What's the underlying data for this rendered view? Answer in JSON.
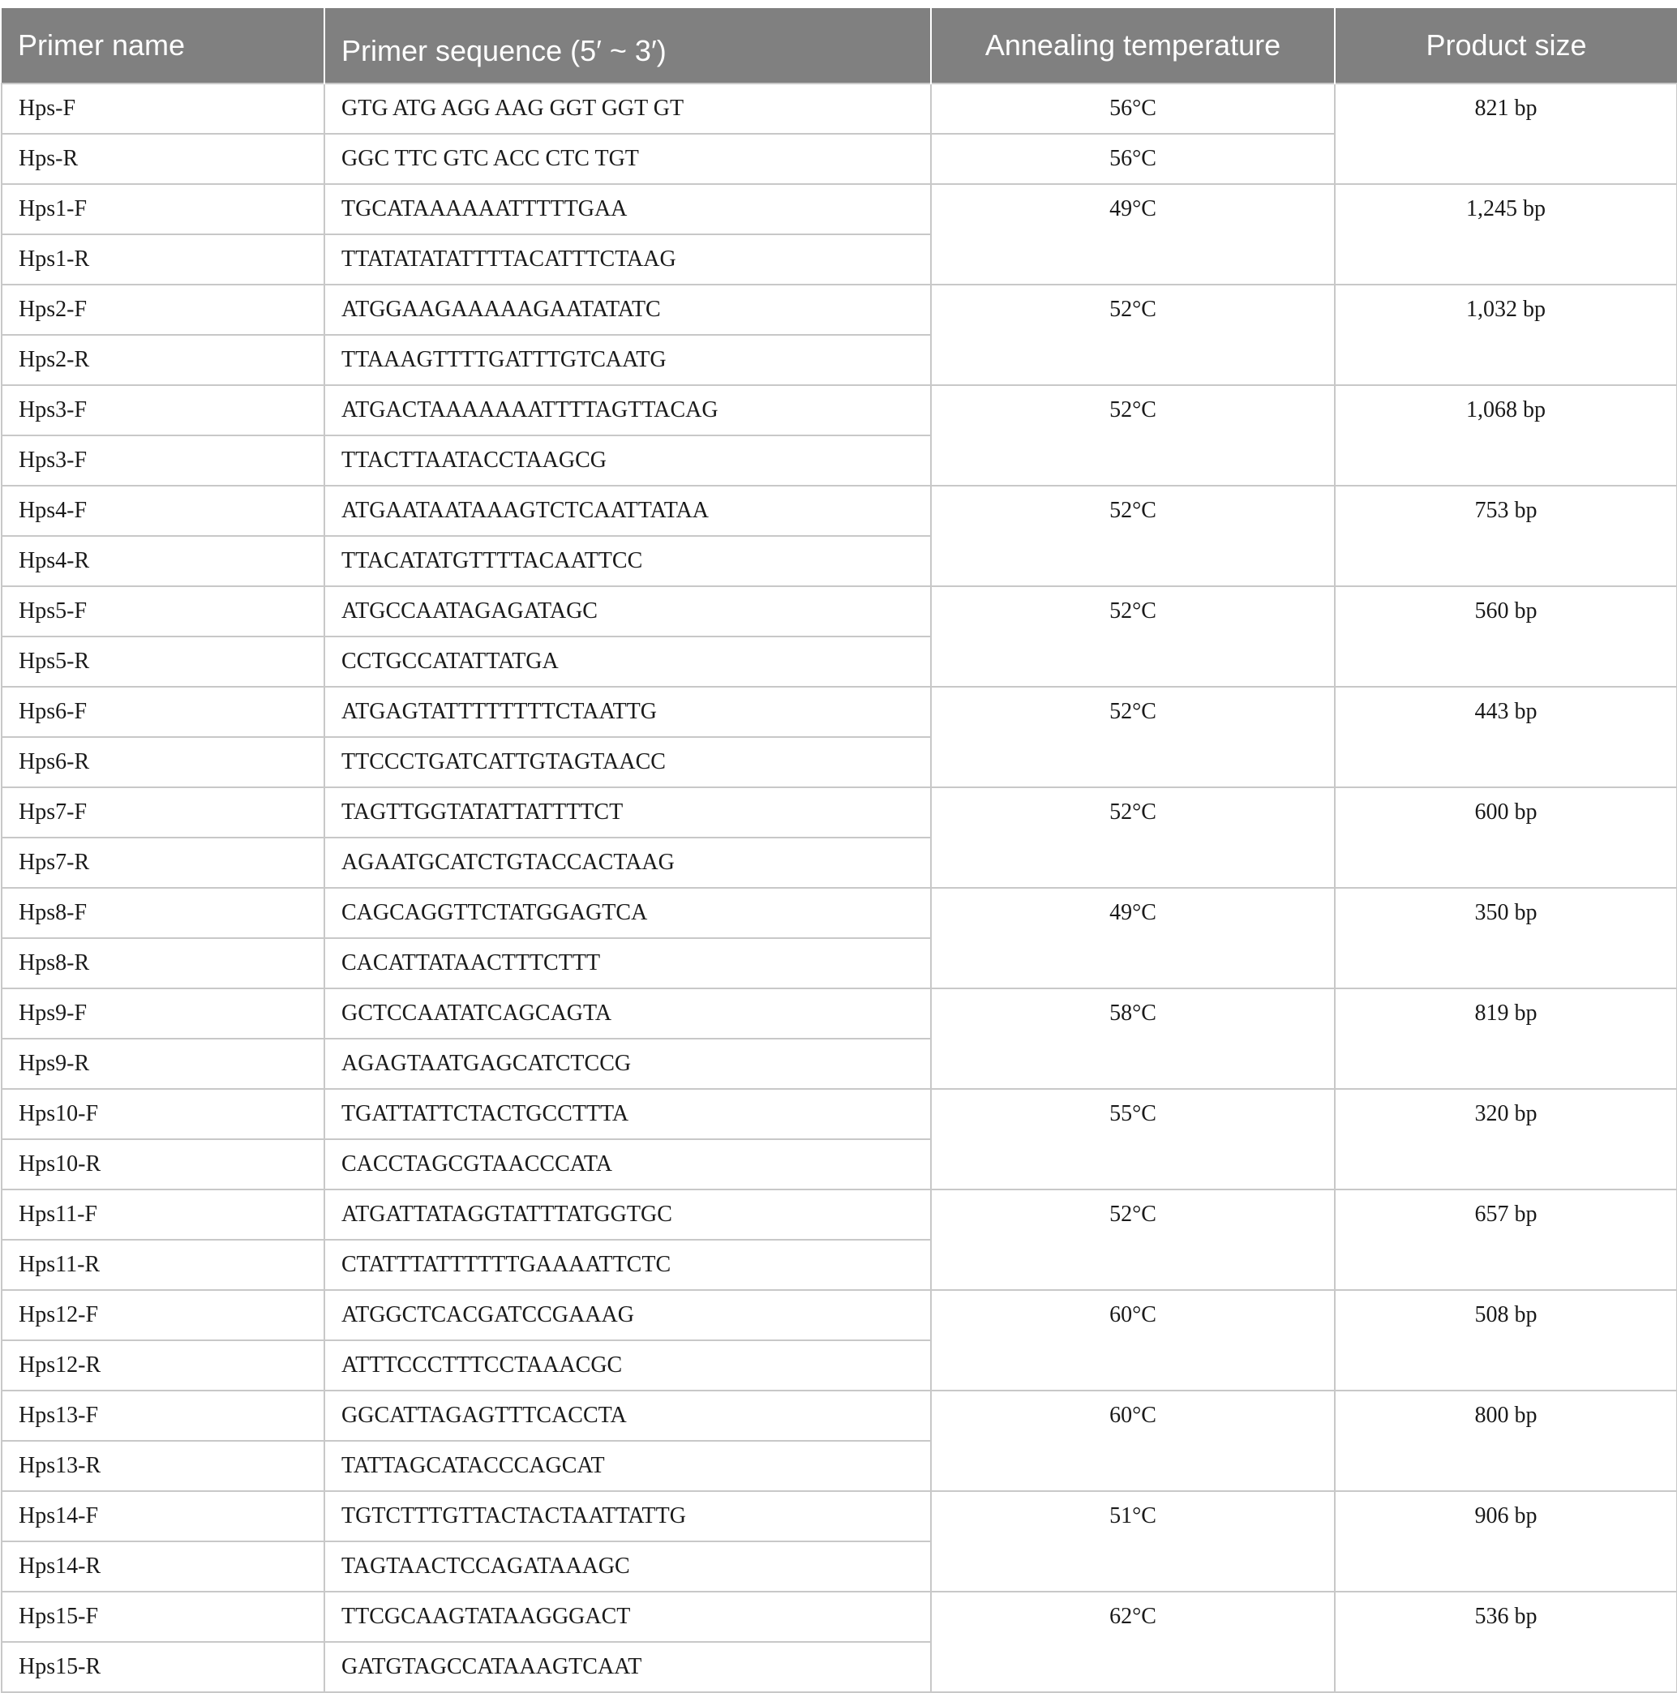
{
  "table": {
    "headers": [
      "Primer name",
      "Primer sequence (5′ ~ 3′)",
      "Annealing temperature",
      "Product size"
    ],
    "groups": [
      {
        "rows": [
          {
            "name": "Hps-F",
            "sequence": "GTG ATG AGG AAG GGT GGT GT",
            "temp": "56°C"
          },
          {
            "name": "Hps-R",
            "sequence": "GGC TTC GTC ACC CTC TGT",
            "temp": "56°C"
          }
        ],
        "size": "821 bp"
      },
      {
        "rows": [
          {
            "name": "Hps1-F",
            "sequence": "TGCATAAAAAATTTTTGAA"
          },
          {
            "name": "Hps1-R",
            "sequence": "TTATATATATTTTACATTTCTAAG"
          }
        ],
        "temp": "49°C",
        "size": "1,245 bp"
      },
      {
        "rows": [
          {
            "name": "Hps2-F",
            "sequence": "ATGGAAGAAAAAGAATATATC"
          },
          {
            "name": "Hps2-R",
            "sequence": "TTAAAGTTTTGATTTGTCAATG"
          }
        ],
        "temp": "52°C",
        "size": "1,032 bp"
      },
      {
        "rows": [
          {
            "name": "Hps3-F",
            "sequence": "ATGACTAAAAAAATTTTAGTTACAG"
          },
          {
            "name": "Hps3-F",
            "sequence": "TTACTTAATACCTAAGCG"
          }
        ],
        "temp": "52°C",
        "size": "1,068 bp"
      },
      {
        "rows": [
          {
            "name": "Hps4-F",
            "sequence": "ATGAATAATAAAGTCTCAATTATAA"
          },
          {
            "name": "Hps4-R",
            "sequence": "TTACATATGTTTTACAATTCC"
          }
        ],
        "temp": "52°C",
        "size": "753 bp"
      },
      {
        "rows": [
          {
            "name": "Hps5-F",
            "sequence": "ATGCCAATAGAGATAGC"
          },
          {
            "name": "Hps5-R",
            "sequence": "CCTGCCATATTATGA"
          }
        ],
        "temp": "52°C",
        "size": "560 bp"
      },
      {
        "rows": [
          {
            "name": "Hps6-F",
            "sequence": "ATGAGTATTTTTTTTCTAATTG"
          },
          {
            "name": "Hps6-R",
            "sequence": "TTCCCTGATCATTGTAGTAACC"
          }
        ],
        "temp": "52°C",
        "size": "443 bp"
      },
      {
        "rows": [
          {
            "name": "Hps7-F",
            "sequence": "TAGTTGGTATATTATTTTCT"
          },
          {
            "name": "Hps7-R",
            "sequence": "AGAATGCATCTGTACCACTAAG"
          }
        ],
        "temp": "52°C",
        "size": "600 bp"
      },
      {
        "rows": [
          {
            "name": "Hps8-F",
            "sequence": "CAGCAGGTTCTATGGAGTCA"
          },
          {
            "name": "Hps8-R",
            "sequence": "CACATTATAACTTTCTTT"
          }
        ],
        "temp": "49°C",
        "size": "350 bp"
      },
      {
        "rows": [
          {
            "name": "Hps9-F",
            "sequence": "GCTCCAATATCAGCAGTA"
          },
          {
            "name": "Hps9-R",
            "sequence": "AGAGTAATGAGCATCTCCG"
          }
        ],
        "temp": "58°C",
        "size": "819 bp"
      },
      {
        "rows": [
          {
            "name": "Hps10-F",
            "sequence": "TGATTATTCTACTGCCTTTA"
          },
          {
            "name": "Hps10-R",
            "sequence": "CACCTAGCGTAACCCATA"
          }
        ],
        "temp": "55°C",
        "size": "320 bp"
      },
      {
        "rows": [
          {
            "name": "Hps11-F",
            "sequence": "ATGATTATAGGTATTTATGGTGC"
          },
          {
            "name": "Hps11-R",
            "sequence": "CTATTTATTTTTTGAAAATTCTC"
          }
        ],
        "temp": "52°C",
        "size": "657 bp"
      },
      {
        "rows": [
          {
            "name": "Hps12-F",
            "sequence": "ATGGCTCACGATCCGAAAG"
          },
          {
            "name": "Hps12-R",
            "sequence": "ATTTCCCTTTCCTAAACGC"
          }
        ],
        "temp": "60°C",
        "size": "508 bp"
      },
      {
        "rows": [
          {
            "name": "Hps13-F",
            "sequence": "GGCATTAGAGTTTCACCTA"
          },
          {
            "name": "Hps13-R",
            "sequence": "TATTAGCATACCCAGCAT"
          }
        ],
        "temp": "60°C",
        "size": "800 bp"
      },
      {
        "rows": [
          {
            "name": "Hps14-F",
            "sequence": "TGTCTTTGTTACTACTAATTATTG"
          },
          {
            "name": "Hps14-R",
            "sequence": "TAGTAACTCCAGATAAAGC"
          }
        ],
        "temp": "51°C",
        "size": "906 bp"
      },
      {
        "rows": [
          {
            "name": "Hps15-F",
            "sequence": "TTCGCAAGTATAAGGGACT"
          },
          {
            "name": "Hps15-R",
            "sequence": "GATGTAGCCATAAAGTCAAT"
          }
        ],
        "temp": "62°C",
        "size": "536 bp"
      }
    ]
  }
}
